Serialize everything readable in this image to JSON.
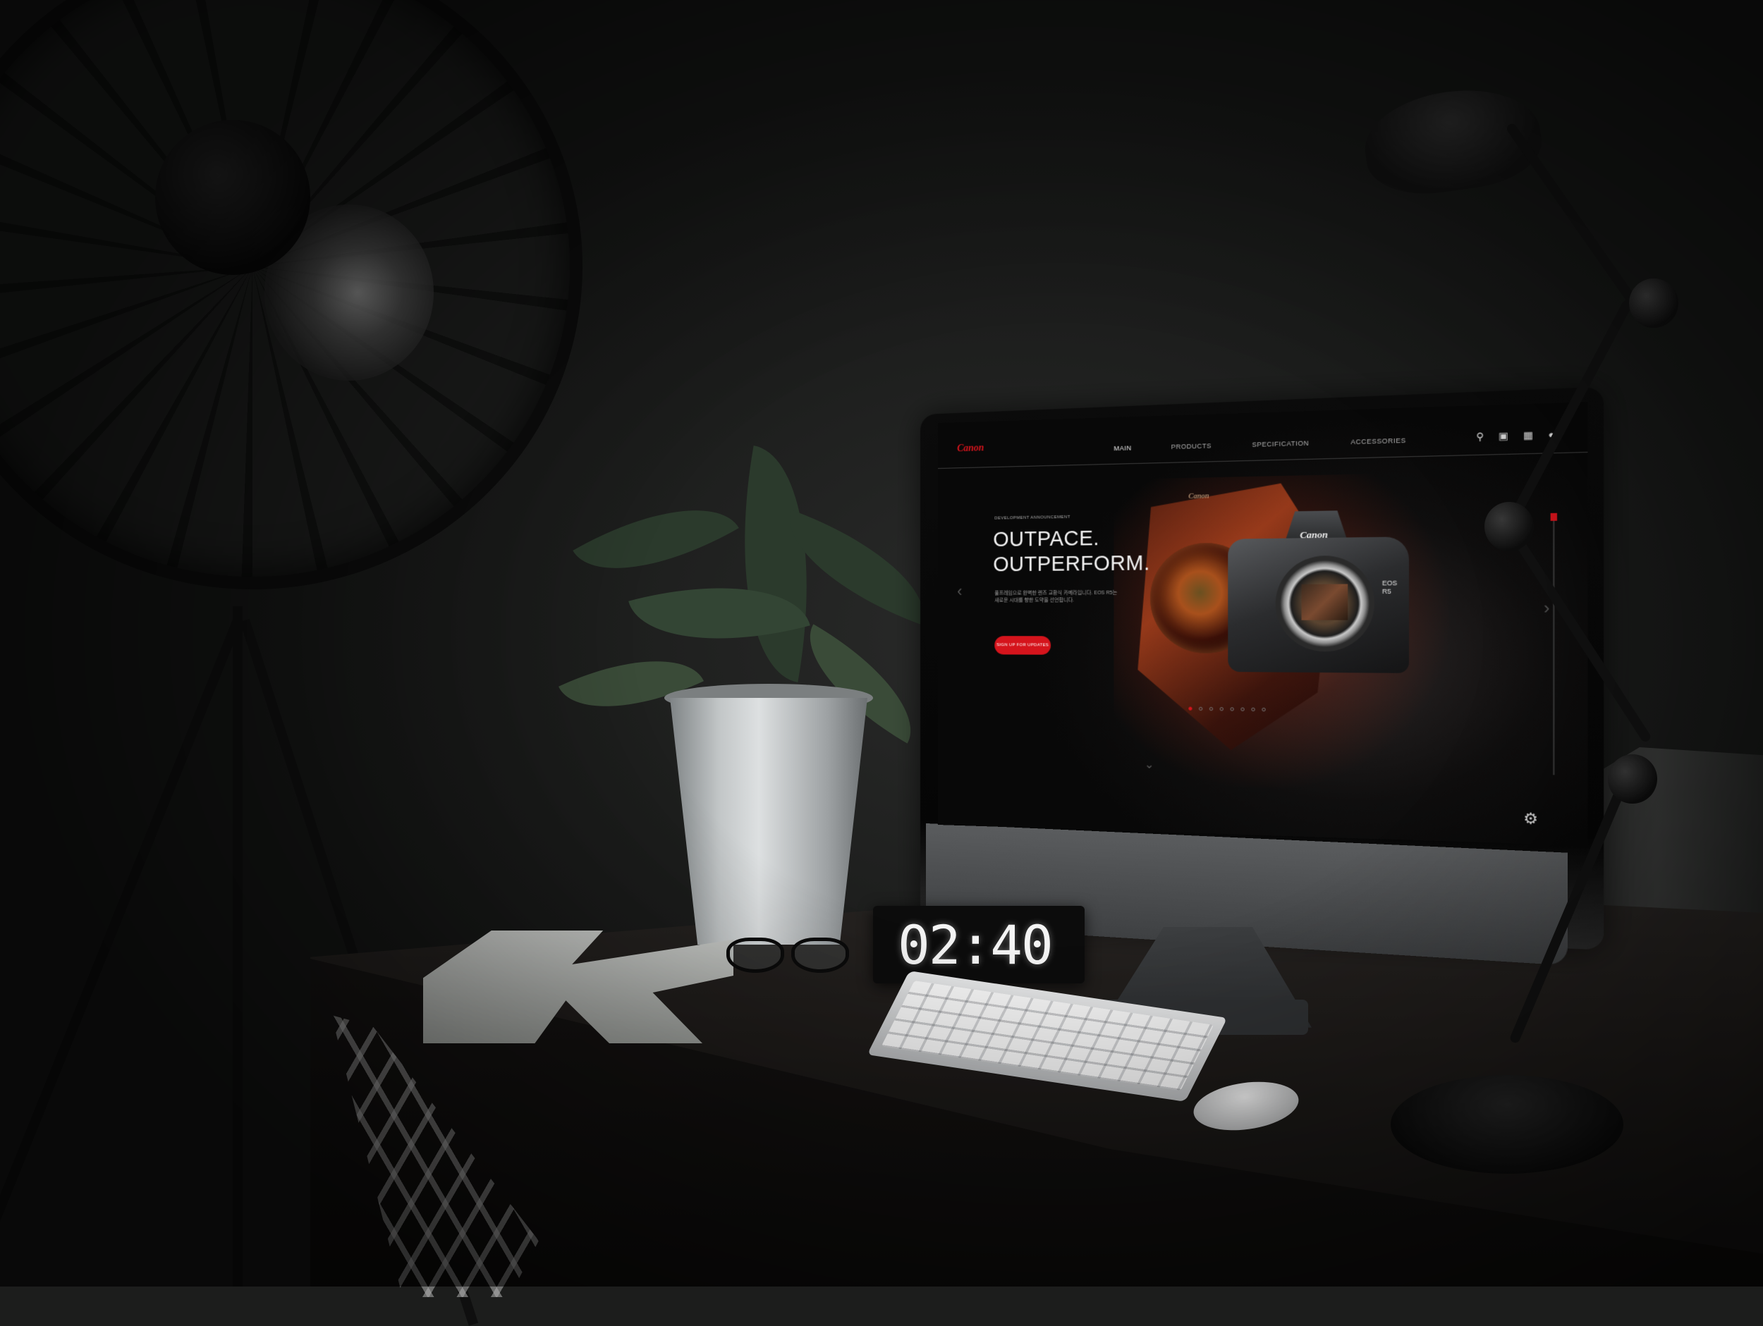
{
  "scene": {
    "description_colors": {
      "wall": "#1c1d1c",
      "accent": "#d5141c"
    }
  },
  "website": {
    "brand": "Canon",
    "nav": {
      "items": [
        "MAIN",
        "PRODUCTS",
        "SPECIFICATION",
        "ACCESSORIES"
      ],
      "active_index": 0,
      "icons": [
        "search-icon",
        "cart-icon",
        "apps-grid-icon",
        "account-icon"
      ]
    },
    "hero": {
      "eyebrow": "DEVELOPMENT ANNOUNCEMENT",
      "headline_line1": "OUTPACE.",
      "headline_line2": "OUTPERFORM.",
      "description": "풀프레임으로 완벽한 렌즈 교환식 카메라입니다. EOS R5는 새로운 시대를 향한 도약을 선언합니다.",
      "cta_label": "SIGN UP FOR UPDATES",
      "product_brand": "Canon",
      "product_model_line1": "EOS",
      "product_model_line2": "R5",
      "slides_total": 8,
      "active_slide": 1
    },
    "settings_icon": "gear-icon"
  },
  "clock": {
    "time": "02:40"
  }
}
